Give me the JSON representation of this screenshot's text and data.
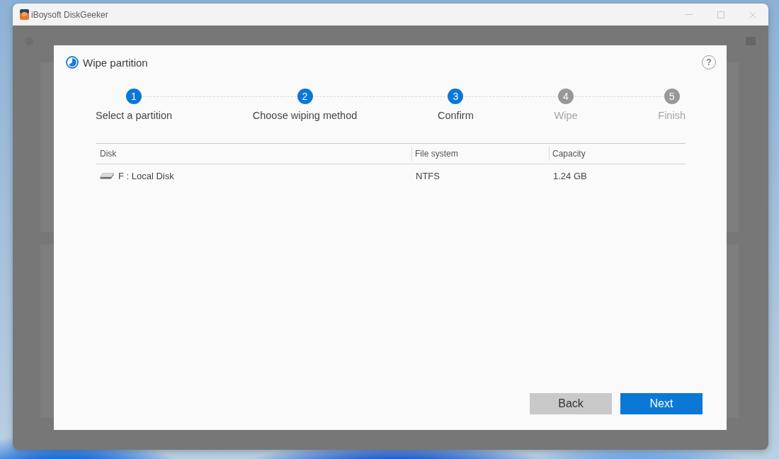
{
  "window": {
    "title": "iBoysoft DiskGeeker",
    "controls": [
      {
        "kind": "minimize",
        "disabled": true
      },
      {
        "kind": "maximize",
        "disabled": true
      },
      {
        "kind": "close",
        "disabled": true
      }
    ]
  },
  "dialog": {
    "title": "Wipe partition",
    "help_label": "?",
    "steps": [
      {
        "number": "1",
        "label": "Select a partition",
        "reached": true
      },
      {
        "number": "2",
        "label": "Choose wiping method",
        "reached": true
      },
      {
        "number": "3",
        "label": "Confirm",
        "reached": true
      },
      {
        "number": "4",
        "label": "Wipe",
        "reached": false
      },
      {
        "number": "5",
        "label": "Finish",
        "reached": false
      }
    ],
    "table": {
      "columns": [
        "Disk",
        "File system",
        "Capacity"
      ],
      "rows": [
        {
          "cells": [
            "F : Local Disk",
            "NTFS",
            "1.24 GB"
          ]
        }
      ]
    },
    "buttons": [
      {
        "label": "Back",
        "kind": "secondary"
      },
      {
        "label": "Next",
        "kind": "primary"
      }
    ]
  }
}
